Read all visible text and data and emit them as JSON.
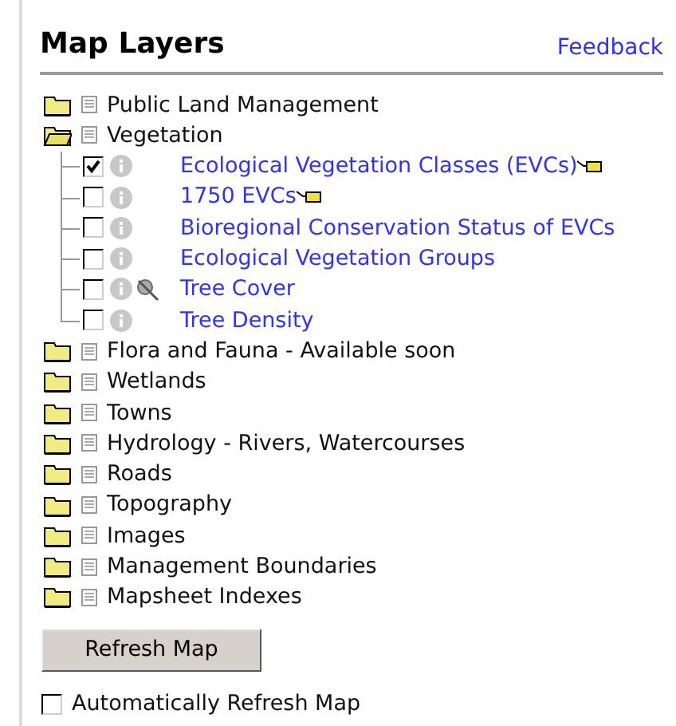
{
  "title": "Map Layers",
  "feedback": "Feedback",
  "groups": [
    {
      "label": "Public Land Management",
      "expanded": false
    },
    {
      "label": "Vegetation",
      "expanded": true,
      "children": [
        {
          "label": "Ecological Vegetation Classes (EVCs)",
          "checked": true,
          "legend": true,
          "scale_warning": false
        },
        {
          "label": "1750 EVCs",
          "checked": false,
          "legend": true,
          "scale_warning": false
        },
        {
          "label": "Bioregional Conservation Status of EVCs",
          "checked": false,
          "legend": false,
          "scale_warning": false
        },
        {
          "label": "Ecological Vegetation Groups",
          "checked": false,
          "legend": false,
          "scale_warning": false
        },
        {
          "label": "Tree Cover",
          "checked": false,
          "legend": false,
          "scale_warning": true
        },
        {
          "label": "Tree Density",
          "checked": false,
          "legend": false,
          "scale_warning": false
        }
      ]
    },
    {
      "label": "Flora and Fauna - Available soon",
      "expanded": false
    },
    {
      "label": "Wetlands",
      "expanded": false
    },
    {
      "label": "Towns",
      "expanded": false
    },
    {
      "label": "Hydrology - Rivers, Watercourses",
      "expanded": false
    },
    {
      "label": "Roads",
      "expanded": false
    },
    {
      "label": "Topography",
      "expanded": false
    },
    {
      "label": "Images",
      "expanded": false
    },
    {
      "label": "Management Boundaries",
      "expanded": false
    },
    {
      "label": "Mapsheet Indexes",
      "expanded": false
    }
  ],
  "refresh_button": "Refresh Map",
  "auto_refresh": {
    "label": "Automatically Refresh Map",
    "checked": false
  }
}
